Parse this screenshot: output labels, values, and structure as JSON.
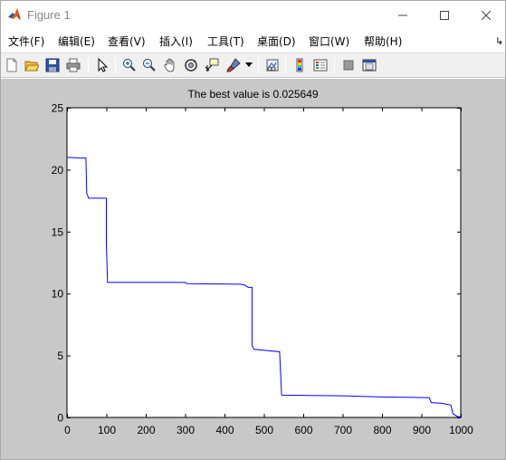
{
  "window": {
    "title": "Figure 1"
  },
  "menu": [
    {
      "label": "文件(F)",
      "name": "menu-file"
    },
    {
      "label": "编辑(E)",
      "name": "menu-edit"
    },
    {
      "label": "查看(V)",
      "name": "menu-view"
    },
    {
      "label": "插入(I)",
      "name": "menu-insert"
    },
    {
      "label": "工具(T)",
      "name": "menu-tools"
    },
    {
      "label": "桌面(D)",
      "name": "menu-desktop"
    },
    {
      "label": "窗口(W)",
      "name": "menu-window"
    },
    {
      "label": "帮助(H)",
      "name": "menu-help"
    }
  ],
  "toolbar_icons": [
    "new-figure-icon",
    "open-file-icon",
    "save-icon",
    "print-icon",
    "edit-plot-arrow-icon",
    "zoom-in-icon",
    "zoom-out-icon",
    "pan-hand-icon",
    "rotate-3d-icon",
    "data-cursor-icon",
    "brush-icon",
    "brush-dropdown-icon",
    "link-plot-icon",
    "colorbar-icon",
    "legend-icon",
    "hide-plot-tools-icon",
    "show-plot-tools-icon"
  ],
  "chart_data": {
    "type": "line",
    "title": "The best value is 0.025649",
    "xlabel": "",
    "ylabel": "",
    "xlim": [
      0,
      1000
    ],
    "ylim": [
      0,
      25
    ],
    "xticks": [
      0,
      100,
      200,
      300,
      400,
      500,
      600,
      700,
      800,
      900,
      1000
    ],
    "yticks": [
      0,
      5,
      10,
      15,
      20,
      25
    ],
    "grid": false,
    "line_color": "#0000ff",
    "series": [
      {
        "x": [
          0,
          30,
          48,
          50,
          55,
          100,
          100,
          103,
          300,
          305,
          440,
          450,
          460,
          470,
          470,
          475,
          540,
          545,
          700,
          750,
          800,
          920,
          925,
          950,
          975,
          980,
          990,
          1000
        ],
        "y": [
          21.0,
          20.95,
          20.95,
          18.1,
          17.7,
          17.7,
          14.0,
          10.9,
          10.9,
          10.8,
          10.75,
          10.7,
          10.5,
          10.5,
          5.8,
          5.5,
          5.3,
          1.8,
          1.75,
          1.7,
          1.65,
          1.6,
          1.2,
          1.15,
          1.0,
          0.3,
          0.1,
          0.025649
        ]
      }
    ]
  }
}
